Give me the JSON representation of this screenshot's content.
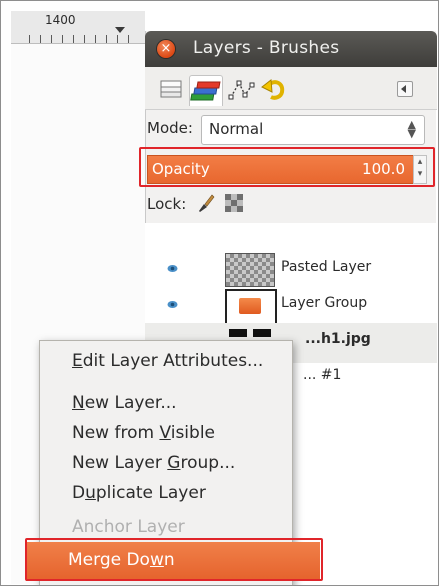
{
  "ruler": {
    "value": "1400"
  },
  "window": {
    "title": "Layers - Brushes",
    "close_symbol": "×"
  },
  "tabs": [
    {
      "name": "layers-tab",
      "icon": "layers-icon"
    },
    {
      "name": "brushes-tab",
      "icon": "brushes-icon"
    },
    {
      "name": "paths-tab",
      "icon": "paths-icon"
    },
    {
      "name": "undo-tab",
      "icon": "undo-history-icon"
    }
  ],
  "mode": {
    "label": "Mode:",
    "value": "Normal"
  },
  "opacity": {
    "label": "Opacity",
    "value": "100.0"
  },
  "lock": {
    "label": "Lock:"
  },
  "layers": [
    {
      "name": "Pasted Layer",
      "visible": true
    },
    {
      "name": "Layer Group",
      "visible": true
    },
    {
      "name": "...h1.jpg",
      "visible": false
    },
    {
      "name": "... #1",
      "visible": false
    }
  ],
  "context_menu": {
    "items": [
      {
        "pre": "",
        "u": "E",
        "post": "dit Layer Attributes...",
        "enabled": true
      },
      {
        "pre": "",
        "u": "N",
        "post": "ew Layer...",
        "enabled": true
      },
      {
        "pre": "New from ",
        "u": "V",
        "post": "isible",
        "enabled": true
      },
      {
        "pre": "New Layer ",
        "u": "G",
        "post": "roup...",
        "enabled": true
      },
      {
        "pre": "D",
        "u": "u",
        "post": "plicate Layer",
        "enabled": true
      },
      {
        "pre": "Anchor Layer",
        "u": "",
        "post": "",
        "enabled": false
      }
    ],
    "merge_down": {
      "pre": "Merge Do",
      "u": "w",
      "post": "n"
    }
  },
  "colors": {
    "accent": "#e8672f",
    "highlight_box": "#e0252a",
    "titlebar": "#3e3d3a"
  }
}
